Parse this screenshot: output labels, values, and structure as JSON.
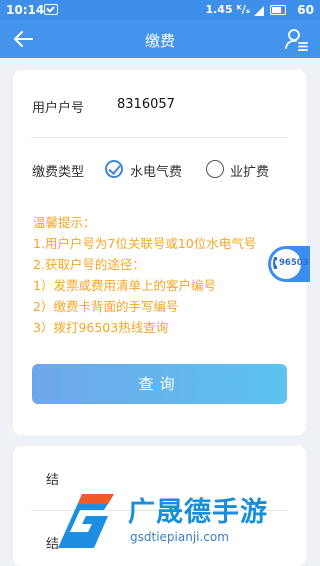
{
  "status_bar": {
    "time": "10:14",
    "speed": "1.45 ᴷ/ₛ",
    "battery": "60"
  },
  "navbar": {
    "title": "缴费"
  },
  "form": {
    "account_label": "用户户号",
    "account_value": "8316057",
    "fee_type_label": "缴费类型",
    "options": [
      {
        "label": "水电气费",
        "checked": true
      },
      {
        "label": "业扩费",
        "checked": false
      }
    ]
  },
  "tips": {
    "title": "温馨提示：",
    "lines": [
      "1.用户户号为7位关联号或10位水电气号",
      "2.获取户号的途径：",
      "1）发票或费用清单上的客户编号",
      "2）缴费卡背面的手写编号",
      "3）拨打96503热线查询"
    ]
  },
  "query_button": "查询",
  "hotline": {
    "number": "96503"
  },
  "results": {
    "row1": "结",
    "row2": "结"
  },
  "watermark": {
    "text": "广晟德手游",
    "url": "gsdtiepianji.com"
  },
  "colors": {
    "primary": "#4494ec",
    "tip": "#f5a623",
    "button_start": "#6fa6ea",
    "button_end": "#5bc4ef"
  }
}
